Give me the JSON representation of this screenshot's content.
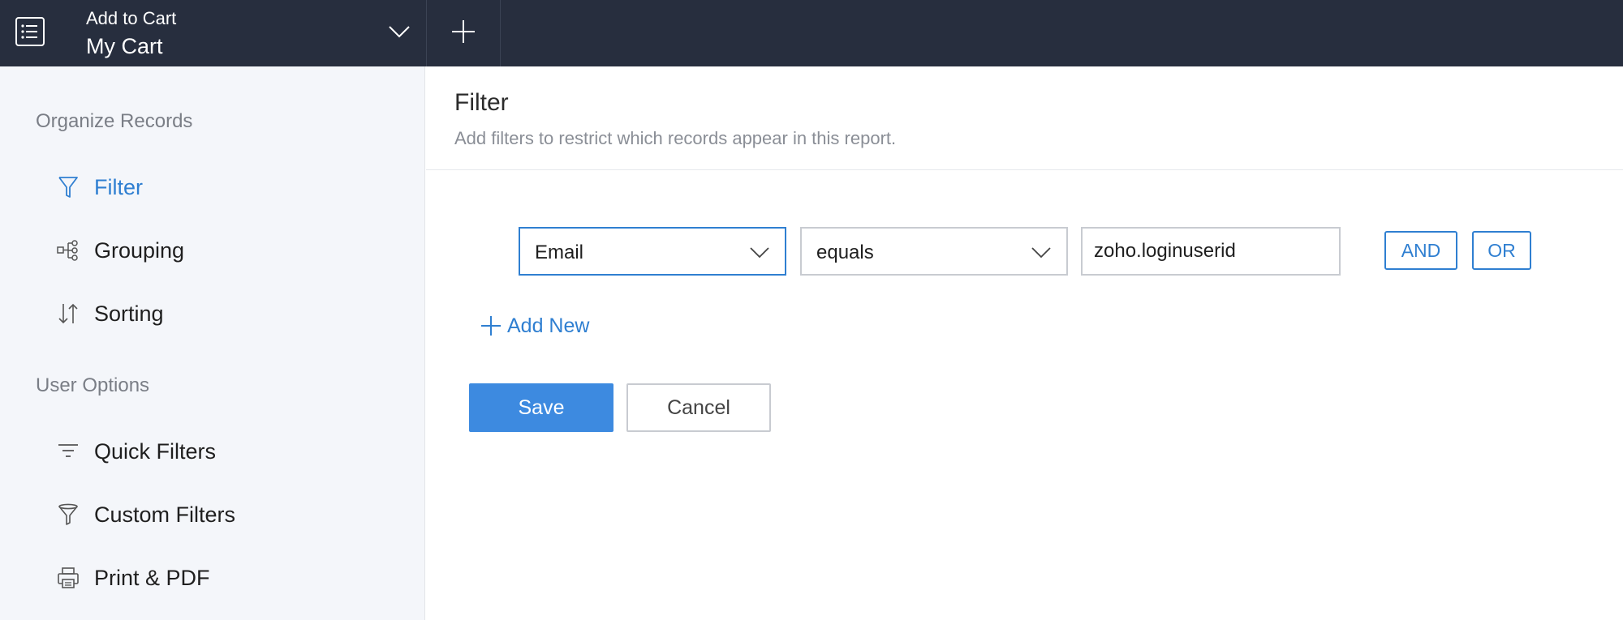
{
  "header": {
    "app_subtitle": "Add to Cart",
    "app_title": "My Cart"
  },
  "sidebar": {
    "organize_title": "Organize Records",
    "organize_items": [
      {
        "label": "Filter",
        "icon": "filter-icon",
        "active": true
      },
      {
        "label": "Grouping",
        "icon": "grouping-icon",
        "active": false
      },
      {
        "label": "Sorting",
        "icon": "sorting-icon",
        "active": false
      }
    ],
    "user_options_title": "User Options",
    "user_items": [
      {
        "label": "Quick Filters",
        "icon": "quick-filters-icon"
      },
      {
        "label": "Custom Filters",
        "icon": "funnel-icon"
      },
      {
        "label": "Print & PDF",
        "icon": "printer-icon"
      }
    ]
  },
  "main": {
    "title": "Filter",
    "description": "Add filters to restrict which records appear in this report.",
    "filter_row": {
      "field_value": "Email",
      "operator_value": "equals",
      "value_input": "zoho.loginuserid",
      "and_label": "AND",
      "or_label": "OR"
    },
    "add_new_label": "Add New",
    "save_label": "Save",
    "cancel_label": "Cancel"
  },
  "colors": {
    "topbar": "#272e3e",
    "accent": "#2f7fd1",
    "primary_button": "#3d8ae0",
    "sidebar_bg": "#f4f6fa"
  }
}
